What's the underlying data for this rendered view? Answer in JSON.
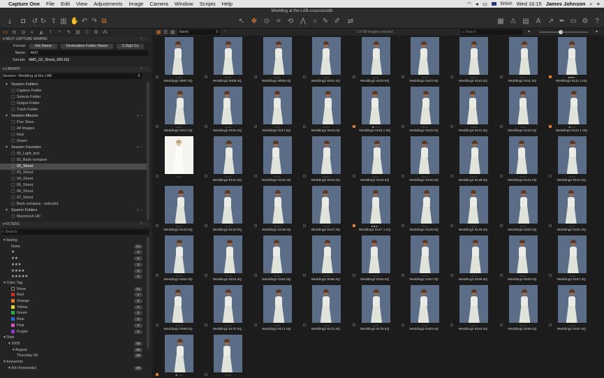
{
  "menubar": {
    "items": [
      "Capture One",
      "File",
      "Edit",
      "View",
      "Adjustments",
      "Image",
      "Camera",
      "Window",
      "Scripts",
      "Help"
    ],
    "keyboard": "British",
    "clock": "Wed 16:15",
    "user": "James Johnson"
  },
  "window": {
    "title": "Wedding at the LAB.cosessiondb"
  },
  "browser": {
    "sort_field": "Name",
    "count_text": "1 of 58 images selected",
    "search_placeholder": "Search"
  },
  "capture_naming": {
    "header": "NEXT CAPTURE NAMING",
    "format_label": "Format",
    "format_tokens": [
      "Job Name",
      "Destination Folder Name",
      "3 Digit Co"
    ],
    "name_label": "Name",
    "name_value": "AM1",
    "sample_label": "Sample",
    "sample_value": "AM1_02_Shoot_050.IIQ"
  },
  "library": {
    "header": "LIBRARY",
    "session_label": "Session: Wedding at the LAB",
    "items": [
      {
        "label": "Session Folders",
        "type": "group"
      },
      {
        "label": "Capture Folder",
        "type": "item"
      },
      {
        "label": "Selects Folder",
        "type": "item"
      },
      {
        "label": "Output Folder",
        "type": "item"
      },
      {
        "label": "Trash Folder",
        "type": "item"
      },
      {
        "label": "Session Albums",
        "type": "group"
      },
      {
        "label": "Five Stars",
        "type": "item"
      },
      {
        "label": "All Images",
        "type": "item"
      },
      {
        "label": "Red",
        "type": "item"
      },
      {
        "label": "Green",
        "type": "item"
      },
      {
        "label": "Session Favorites",
        "type": "group"
      },
      {
        "label": "00_Light_test",
        "type": "item"
      },
      {
        "label": "01_Back compare",
        "type": "item"
      },
      {
        "label": "02_Shoot",
        "type": "item",
        "selected": true
      },
      {
        "label": "03_Shoot",
        "type": "item"
      },
      {
        "label": "04_Shoot",
        "type": "item"
      },
      {
        "label": "05_Shoot",
        "type": "item"
      },
      {
        "label": "06_Shoot",
        "type": "item"
      },
      {
        "label": "07_Shoot",
        "type": "item"
      },
      {
        "label": "Back compare - selected",
        "type": "item"
      },
      {
        "label": "System Folders",
        "type": "group"
      },
      {
        "label": "Macintosh HD",
        "type": "item"
      }
    ]
  },
  "filters": {
    "header": "FILTERS",
    "search_placeholder": "Search",
    "rows": [
      {
        "label": "Rating",
        "type": "group",
        "count": ""
      },
      {
        "label": "None",
        "type": "item",
        "count": "51"
      },
      {
        "label": "★",
        "type": "item",
        "count": "0"
      },
      {
        "label": "★★",
        "type": "item",
        "count": "0"
      },
      {
        "label": "★★★",
        "type": "item",
        "count": "2"
      },
      {
        "label": "★★★★",
        "type": "item",
        "count": "3"
      },
      {
        "label": "★★★★★",
        "type": "item",
        "count": "2"
      },
      {
        "label": "Color Tag",
        "type": "group",
        "count": ""
      },
      {
        "label": "None",
        "type": "color",
        "color": "#1c1c1c",
        "count": "51"
      },
      {
        "label": "Red",
        "type": "color",
        "color": "#d02a2a",
        "count": "0"
      },
      {
        "label": "Orange",
        "type": "color",
        "color": "#e27b2c",
        "count": "5"
      },
      {
        "label": "Yellow",
        "type": "color",
        "color": "#e5d32a",
        "count": "0"
      },
      {
        "label": "Green",
        "type": "color",
        "color": "#2fae3b",
        "count": "0"
      },
      {
        "label": "Blue",
        "type": "color",
        "color": "#2f62d6",
        "count": "0"
      },
      {
        "label": "Pink",
        "type": "color",
        "color": "#d14fb9",
        "count": "0"
      },
      {
        "label": "Purple",
        "type": "color",
        "color": "#8a3fd1",
        "count": "0"
      },
      {
        "label": "Date",
        "type": "group",
        "count": ""
      },
      {
        "label": "2009",
        "type": "sub1",
        "count": "58"
      },
      {
        "label": "August",
        "type": "sub2",
        "count": "58"
      },
      {
        "label": "Thursday 06",
        "type": "sub3",
        "count": "58"
      },
      {
        "label": "Keywords",
        "type": "group",
        "count": ""
      },
      {
        "label": "(No Keywords)",
        "type": "sub1",
        "count": "58"
      }
    ]
  },
  "thumbs": [
    {
      "n": "Wedding2 9097.IIQ",
      "s": 0,
      "t": ""
    },
    {
      "n": "Wedding2 9098.IIQ",
      "s": 0,
      "t": ""
    },
    {
      "n": "Wedding2 9099.IIQ",
      "s": 0,
      "t": ""
    },
    {
      "n": "Wedding2 9101.IIQ",
      "s": 0,
      "t": ""
    },
    {
      "n": "Wedding2 9102.IIQ",
      "s": 0,
      "t": ""
    },
    {
      "n": "Wedding2 9103.IIQ",
      "s": 0,
      "t": ""
    },
    {
      "n": "Wedding2 9110.IIQ",
      "s": 0,
      "t": ""
    },
    {
      "n": "Wedding2 9111.IIQ",
      "s": 0,
      "t": ""
    },
    {
      "n": "Wedding2 9111 1.IIQ",
      "s": 3,
      "t": "orange"
    },
    {
      "n": "Wedding2 9114.IIQ",
      "s": 0,
      "t": ""
    },
    {
      "n": "Wedding2 9115.IIQ",
      "s": 0,
      "t": ""
    },
    {
      "n": "Wedding2 9117.IIQ",
      "s": 0,
      "t": ""
    },
    {
      "n": "Wedding2 9118.IIQ",
      "s": 0,
      "t": ""
    },
    {
      "n": "Wedding2 9118 1.IIQ",
      "s": 1,
      "t": "orange"
    },
    {
      "n": "Wedding2 9120.IIQ",
      "s": 0,
      "t": ""
    },
    {
      "n": "Wedding2 9121.IIQ",
      "s": 0,
      "t": ""
    },
    {
      "n": "Wedding2 9122.IIQ",
      "s": 0,
      "t": ""
    },
    {
      "n": "Wedding2 9122 1.IIQ",
      "s": 1,
      "t": "orange"
    },
    {
      "n": "",
      "s": 0,
      "t": "",
      "sel": true
    },
    {
      "n": "Wedding2 9131.IIQ",
      "s": 0,
      "t": ""
    },
    {
      "n": "Wedding2 9132.IIQ",
      "s": 0,
      "t": ""
    },
    {
      "n": "Wedding2 9133.IIQ",
      "s": 0,
      "t": ""
    },
    {
      "n": "Wedding2 9134.IIQ",
      "s": 0,
      "t": ""
    },
    {
      "n": "Wedding2 9136.IIQ",
      "s": 0,
      "t": ""
    },
    {
      "n": "Wedding2 9138.IIQ",
      "s": 0,
      "t": ""
    },
    {
      "n": "Wedding2 9141.IIQ",
      "s": 0,
      "t": ""
    },
    {
      "n": "Wedding2 9142.IIQ",
      "s": 0,
      "t": ""
    },
    {
      "n": "Wedding2 9143.IIQ",
      "s": 0,
      "t": ""
    },
    {
      "n": "Wedding2 9144.IIQ",
      "s": 0,
      "t": ""
    },
    {
      "n": "Wedding2 9146.IIQ",
      "s": 0,
      "t": ""
    },
    {
      "n": "Wedding2 9147.IIQ",
      "s": 0,
      "t": ""
    },
    {
      "n": "Wedding2 9147 1.IIQ",
      "s": 3,
      "t": "orange"
    },
    {
      "n": "Wedding2 9148.IIQ",
      "s": 0,
      "t": ""
    },
    {
      "n": "Wedding2 9149.IIQ",
      "s": 0,
      "t": ""
    },
    {
      "n": "Wedding2 9150.IIQ",
      "s": 0,
      "t": ""
    },
    {
      "n": "Wedding2 9151.IIQ",
      "s": 0,
      "t": ""
    },
    {
      "n": "Wedding2 9152.IIQ",
      "s": 0,
      "t": ""
    },
    {
      "n": "Wedding2 9153.IIQ",
      "s": 0,
      "t": ""
    },
    {
      "n": "Wedding2 9154.IIQ",
      "s": 0,
      "t": ""
    },
    {
      "n": "Wedding2 9155.IIQ",
      "s": 0,
      "t": ""
    },
    {
      "n": "Wedding2 9156.IIQ",
      "s": 0,
      "t": ""
    },
    {
      "n": "Wedding2 9157.IIQ",
      "s": 0,
      "t": ""
    },
    {
      "n": "Wedding2 9158.IIQ",
      "s": 0,
      "t": ""
    },
    {
      "n": "Wedding2 9160.IIQ",
      "s": 0,
      "t": ""
    },
    {
      "n": "Wedding2 9167.IIQ",
      "s": 0,
      "t": ""
    },
    {
      "n": "Wedding2 9168.IIQ",
      "s": 0,
      "t": ""
    },
    {
      "n": "Wedding2 9170.IIQ",
      "s": 0,
      "t": ""
    },
    {
      "n": "Wedding2 9171.IIQ",
      "s": 0,
      "t": ""
    },
    {
      "n": "Wedding2 9172.IIQ",
      "s": 0,
      "t": ""
    },
    {
      "n": "Wedding2 9178.IIQ",
      "s": 0,
      "t": ""
    },
    {
      "n": "Wedding2 9183.IIQ",
      "s": 0,
      "t": ""
    },
    {
      "n": "Wedding2 9184.IIQ",
      "s": 0,
      "t": ""
    },
    {
      "n": "Wedding2 9186.IIQ",
      "s": 0,
      "t": ""
    },
    {
      "n": "Wedding2 9187.IIQ",
      "s": 0,
      "t": ""
    },
    {
      "n": "",
      "s": 1,
      "t": "orange"
    },
    {
      "n": "",
      "s": 0,
      "t": ""
    }
  ]
}
